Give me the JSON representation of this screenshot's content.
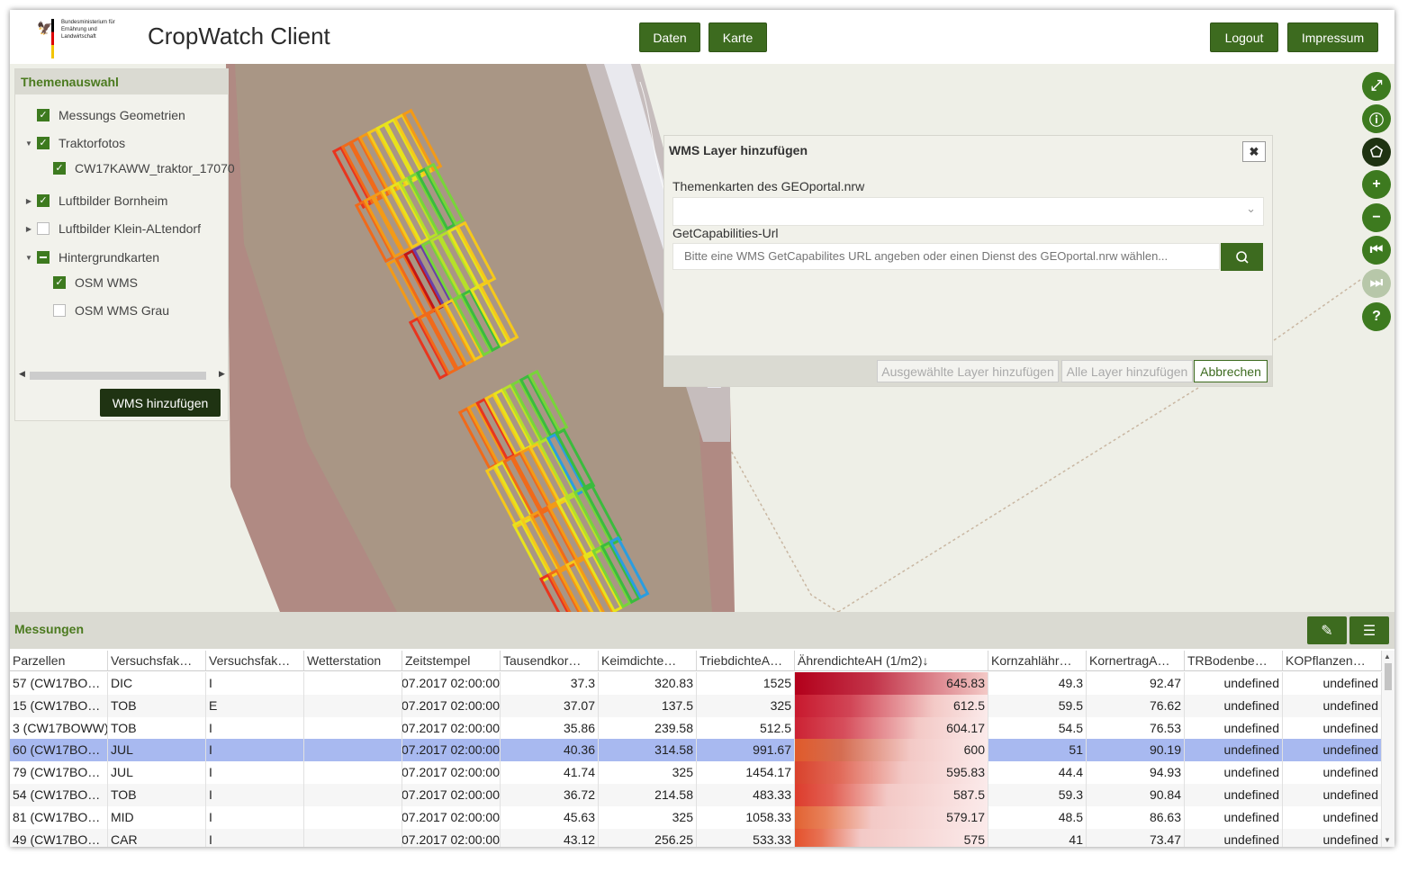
{
  "header": {
    "logo_text": "Bundesministerium für Ernährung und Landwirtschaft",
    "app_title": "CropWatch Client",
    "buttons": {
      "daten": "Daten",
      "karte": "Karte",
      "logout": "Logout",
      "impressum": "Impressum"
    }
  },
  "sidebar": {
    "title": "Themenauswahl",
    "items": [
      {
        "label": "Messungs Geometrien",
        "state": "checked",
        "caret": ""
      },
      {
        "label": "Traktorfotos",
        "state": "checked",
        "caret": "expanded"
      },
      {
        "label": "CW17KAWW_traktor_17070",
        "state": "checked",
        "caret": ""
      },
      {
        "label": "Luftbilder Bornheim",
        "state": "checked",
        "caret": "collapsed"
      },
      {
        "label": "Luftbilder Klein-ALtendorf",
        "state": "unchecked",
        "caret": "collapsed"
      },
      {
        "label": "Hintergrundkarten",
        "state": "indeterminate",
        "caret": "expanded"
      },
      {
        "label": "OSM WMS",
        "state": "checked",
        "caret": ""
      },
      {
        "label": "OSM WMS Grau",
        "state": "unchecked",
        "caret": ""
      }
    ],
    "wms_button": "WMS hinzufügen"
  },
  "toolbar": {
    "icons": [
      "fullscreen-icon",
      "info-icon",
      "lasso-icon",
      "zoom-in-icon",
      "zoom-out-icon",
      "history-back-icon",
      "history-forward-icon",
      "help-icon"
    ]
  },
  "dialog": {
    "title": "WMS Layer hinzufügen",
    "close_symbol": "✖",
    "select_label": "Themenkarten des GEOportal.nrw",
    "select_value": "",
    "url_label": "GetCapabilities-Url",
    "url_placeholder": "Bitte eine WMS GetCapabilites URL angeben oder einen Dienst des GEOportal.nrw wählen...",
    "buttons": {
      "add_selected": "Ausgewählte Layer hinzufügen",
      "add_all": "Alle Layer hinzufügen",
      "cancel": "Abbrechen"
    }
  },
  "measurements": {
    "title": "Messungen",
    "columns": [
      "Parzellen",
      "Versuchsfak…",
      "Versuchsfak…",
      "Wetterstation",
      "Zeitstempel",
      "Tausendkor…",
      "Keimdichte…",
      "TriebdichteA…",
      "ÄhrendichteAH (1/m2)",
      "Kornzahlähr…",
      "KornertragA…",
      "TRBodenbe…",
      "KOPflanzen…"
    ],
    "sort_indicator": "↓",
    "rows": [
      [
        "57 (CW17BO…",
        "DIC",
        "I",
        "",
        "07.2017 02:00:00",
        "37.3",
        "320.83",
        "1525",
        "645.83",
        "49.3",
        "92.47",
        "undefined",
        "undefined"
      ],
      [
        "15 (CW17BO…",
        "TOB",
        "E",
        "",
        "07.2017 02:00:00",
        "37.07",
        "137.5",
        "325",
        "612.5",
        "59.5",
        "76.62",
        "undefined",
        "undefined"
      ],
      [
        "3 (CW17BOWW)",
        "TOB",
        "I",
        "",
        "07.2017 02:00:00",
        "35.86",
        "239.58",
        "512.5",
        "604.17",
        "54.5",
        "76.53",
        "undefined",
        "undefined"
      ],
      [
        "60 (CW17BO…",
        "JUL",
        "I",
        "",
        "07.2017 02:00:00",
        "40.36",
        "314.58",
        "991.67",
        "600",
        "51",
        "90.19",
        "undefined",
        "undefined"
      ],
      [
        "79 (CW17BO…",
        "JUL",
        "I",
        "",
        "07.2017 02:00:00",
        "41.74",
        "325",
        "1454.17",
        "595.83",
        "44.4",
        "94.93",
        "undefined",
        "undefined"
      ],
      [
        "54 (CW17BO…",
        "TOB",
        "I",
        "",
        "07.2017 02:00:00",
        "36.72",
        "214.58",
        "483.33",
        "587.5",
        "59.3",
        "90.84",
        "undefined",
        "undefined"
      ],
      [
        "81 (CW17BO…",
        "MID",
        "I",
        "",
        "07.2017 02:00:00",
        "45.63",
        "325",
        "1058.33",
        "579.17",
        "48.5",
        "86.63",
        "undefined",
        "undefined"
      ],
      [
        "49 (CW17BO…",
        "CAR",
        "I",
        "",
        "07.2017 02:00:00",
        "43.12",
        "256.25",
        "533.33",
        "575",
        "41",
        "73.47",
        "undefined",
        "undefined"
      ]
    ],
    "selected_row": 3,
    "heat_column": 8,
    "heat_fill": [
      1.0,
      0.72,
      0.64,
      0.6,
      0.56,
      0.48,
      0.4,
      0.34
    ],
    "heat_colors": [
      "#b3001b",
      "#c8192e",
      "#cc2233",
      "#e05a2a",
      "#d9422c",
      "#dd3c2c",
      "#e26232",
      "#e4512c"
    ],
    "selected_color": "#a8b9f0"
  }
}
